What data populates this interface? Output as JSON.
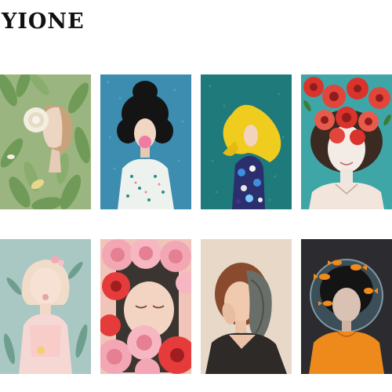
{
  "brand": {
    "name": "YIONE"
  },
  "gallery": {
    "items": [
      {
        "subject": "girl-with-white-rose-and-leaves",
        "bg": "#9ab57f"
      },
      {
        "subject": "girl-with-bun-blowing-bubblegum",
        "bg": "#3c8db0"
      },
      {
        "subject": "yellow-haired-girl-in-floral-dress",
        "bg": "#1f7a7c"
      },
      {
        "subject": "girl-with-red-flowers-over-eyes",
        "bg": "#3fa6a8"
      },
      {
        "subject": "blonde-girl-with-flower-in-mouth",
        "bg": "#a9c7c3"
      },
      {
        "subject": "face-surrounded-by-pink-flowers",
        "bg": "#f0c4b8"
      },
      {
        "subject": "woman-with-scarf-over-face",
        "bg": "#e8d8c8"
      },
      {
        "subject": "woman-in-fishbowl-with-goldfish",
        "bg": "#2b2b30"
      }
    ]
  }
}
